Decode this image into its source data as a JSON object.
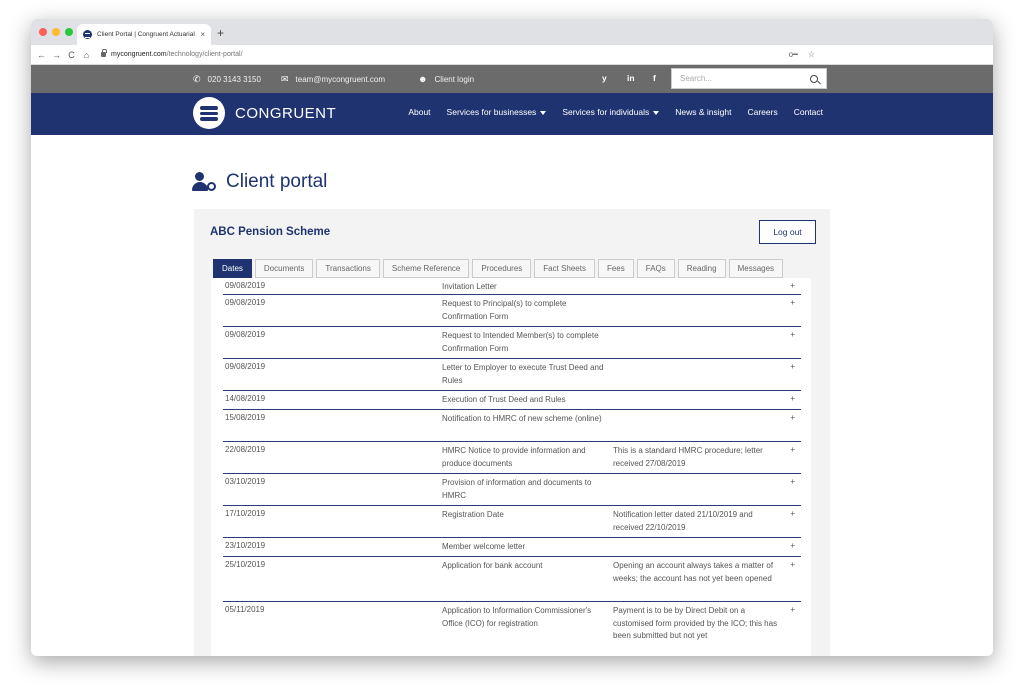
{
  "browser": {
    "tab_title": "Client Portal | Congruent Actuarial",
    "tab_close": "×",
    "new_tab": "+",
    "url_host": "mycongruent.com",
    "url_path": "/technology/client-portal/",
    "nav": {
      "back": "←",
      "forward": "→",
      "reload": "C",
      "home": "⌂"
    },
    "key_icon": "o━",
    "star_icon": "☆"
  },
  "topbar": {
    "phone": "020 3143 3150",
    "email": "team@mycongruent.com",
    "login": "Client login",
    "social": [
      "twitter-icon",
      "linkedin-icon",
      "facebook-icon"
    ],
    "social_glyphs": [
      "y",
      "in",
      "f"
    ],
    "search_placeholder": "Search..."
  },
  "nav": {
    "logo_text": "CONGRUENT",
    "items": [
      "About",
      "Services for businesses",
      "Services for individuals",
      "News & insight",
      "Careers",
      "Contact"
    ]
  },
  "page": {
    "title": "Client portal",
    "scheme_name": "ABC Pension Scheme",
    "logout_label": "Log out",
    "tabs": [
      "Dates",
      "Documents",
      "Transactions",
      "Scheme Reference",
      "Procedures",
      "Fact Sheets",
      "Fees",
      "FAQs",
      "Reading",
      "Messages"
    ],
    "active_tab": "Dates",
    "expand_symbol": "+",
    "rows": [
      {
        "date": "09/08/2019",
        "event": "Invitation Letter",
        "note": ""
      },
      {
        "date": "09/08/2019",
        "event": "Request to Principal(s) to complete Confirmation Form",
        "note": ""
      },
      {
        "date": "09/08/2019",
        "event": "Request to Intended Member(s) to complete Confirmation Form",
        "note": ""
      },
      {
        "date": "09/08/2019",
        "event": "Letter to Employer to execute Trust Deed and Rules",
        "note": ""
      },
      {
        "date": "14/08/2019",
        "event": "Execution of Trust Deed and Rules",
        "note": ""
      },
      {
        "date": "15/08/2019",
        "event": "Notification to HMRC of new scheme (online)",
        "note": ""
      },
      {
        "date": "22/08/2019",
        "event": "HMRC Notice to provide information and produce documents",
        "note": "This is a standard HMRC procedure; letter received 27/08/2019"
      },
      {
        "date": "03/10/2019",
        "event": "Provision of information and documents to HMRC",
        "note": ""
      },
      {
        "date": "17/10/2019",
        "event": "Registration Date",
        "note": "Notification letter dated 21/10/2019 and received 22/10/2019"
      },
      {
        "date": "23/10/2019",
        "event": "Member welcome letter",
        "note": ""
      },
      {
        "date": "25/10/2019",
        "event": "Application for bank account",
        "note": "Opening an account always takes a matter of weeks; the account has not yet been opened"
      },
      {
        "date": "05/11/2019",
        "event": "Application to Information Commissioner's Office (ICO) for registration",
        "note": "Payment is to be by Direct Debit on a customised form provided by the ICO; this has been submitted but not yet"
      }
    ]
  },
  "colors": {
    "brand_navy": "#1e3370",
    "topbar_grey": "#6b6b6b"
  }
}
